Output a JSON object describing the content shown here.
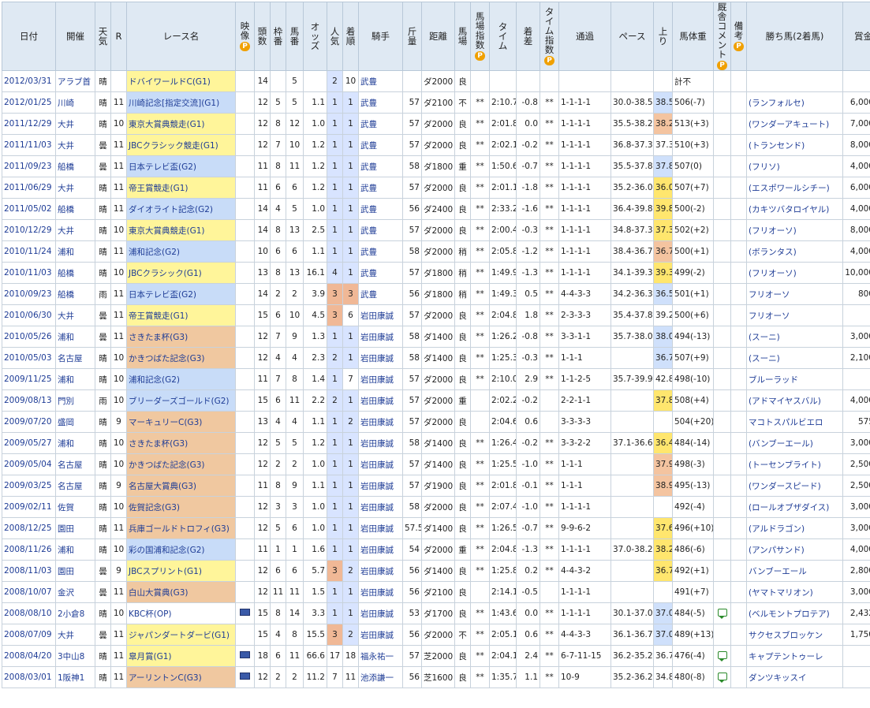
{
  "headers": [
    {
      "label": "日付",
      "pbadge": false
    },
    {
      "label": "開催",
      "pbadge": false
    },
    {
      "label": "天気",
      "pbadge": false,
      "vertical": true
    },
    {
      "label": "R",
      "pbadge": false
    },
    {
      "label": "レース名",
      "pbadge": false
    },
    {
      "label": "映像",
      "pbadge": true,
      "vertical": true
    },
    {
      "label": "頭数",
      "pbadge": false,
      "vertical": true
    },
    {
      "label": "枠番",
      "pbadge": false,
      "vertical": true
    },
    {
      "label": "馬番",
      "pbadge": false,
      "vertical": true
    },
    {
      "label": "オッズ",
      "pbadge": false,
      "vertical": true
    },
    {
      "label": "人気",
      "pbadge": false,
      "vertical": true
    },
    {
      "label": "着順",
      "pbadge": false,
      "vertical": true
    },
    {
      "label": "騎手",
      "pbadge": false
    },
    {
      "label": "斤量",
      "pbadge": false,
      "vertical": true
    },
    {
      "label": "距離",
      "pbadge": false
    },
    {
      "label": "馬場",
      "pbadge": false,
      "vertical": true
    },
    {
      "label": "馬場指数",
      "pbadge": true,
      "vertical": true
    },
    {
      "label": "タイム",
      "pbadge": false,
      "vertical": true
    },
    {
      "label": "着差",
      "pbadge": false,
      "vertical": true
    },
    {
      "label": "タイム指数",
      "pbadge": true,
      "vertical": true
    },
    {
      "label": "通過",
      "pbadge": false
    },
    {
      "label": "ペース",
      "pbadge": false
    },
    {
      "label": "上り",
      "pbadge": false,
      "vertical": true
    },
    {
      "label": "馬体重",
      "pbadge": false
    },
    {
      "label": "厩舎コメント",
      "pbadge": true,
      "vertical": true
    },
    {
      "label": "備考",
      "pbadge": true,
      "vertical": true
    },
    {
      "label": "勝ち馬(2着馬)",
      "pbadge": false
    },
    {
      "label": "賞金",
      "pbadge": false
    }
  ],
  "rows": [
    [
      "2012/03/31",
      "アラブ首",
      "晴",
      "",
      "ドバイワールドC(G1)",
      "",
      "14",
      "",
      "5",
      "",
      "2",
      "10",
      "武豊",
      "",
      "ダ2000",
      "良",
      "",
      "",
      "",
      "",
      "",
      "",
      "",
      "計不",
      "",
      "",
      "",
      ""
    ],
    [
      "2012/01/25",
      "川崎",
      "晴",
      "11",
      "川崎記念[指定交流](G1)",
      "",
      "12",
      "5",
      "5",
      "1.1",
      "1",
      "1",
      "武豊",
      "57",
      "ダ2100",
      "不",
      "**",
      "2:10.7",
      "-0.8",
      "**",
      "1-1-1-1",
      "30.0-38.5",
      "38.5",
      "506(-7)",
      "",
      "",
      "(ランフォルセ)",
      "6,000.0"
    ],
    [
      "2011/12/29",
      "大井",
      "晴",
      "10",
      "東京大賞典競走(G1)",
      "",
      "12",
      "8",
      "12",
      "1.0",
      "1",
      "1",
      "武豊",
      "57",
      "ダ2000",
      "良",
      "**",
      "2:01.8",
      "0.0",
      "**",
      "1-1-1-1",
      "35.5-38.2",
      "38.2",
      "513(+3)",
      "",
      "",
      "(ワンダーアキュート)",
      "7,000.0"
    ],
    [
      "2011/11/03",
      "大井",
      "曇",
      "11",
      "JBCクラシック競走(G1)",
      "",
      "12",
      "7",
      "10",
      "1.2",
      "1",
      "1",
      "武豊",
      "57",
      "ダ2000",
      "良",
      "**",
      "2:02.1",
      "-0.2",
      "**",
      "1-1-1-1",
      "36.8-37.3",
      "37.3",
      "510(+3)",
      "",
      "",
      "(トランセンド)",
      "8,000.0"
    ],
    [
      "2011/09/23",
      "船橋",
      "曇",
      "11",
      "日本テレビ盃(G2)",
      "",
      "11",
      "8",
      "11",
      "1.2",
      "1",
      "1",
      "武豊",
      "58",
      "ダ1800",
      "重",
      "**",
      "1:50.6",
      "-0.7",
      "**",
      "1-1-1-1",
      "35.5-37.8",
      "37.8",
      "507(0)",
      "",
      "",
      "(フリソ)",
      "4,000.0"
    ],
    [
      "2011/06/29",
      "大井",
      "晴",
      "11",
      "帝王賞競走(G1)",
      "",
      "11",
      "6",
      "6",
      "1.2",
      "1",
      "1",
      "武豊",
      "57",
      "ダ2000",
      "良",
      "**",
      "2:01.1",
      "-1.8",
      "**",
      "1-1-1-1",
      "35.2-36.0",
      "36.0",
      "507(+7)",
      "",
      "",
      "(エスポワールシチー)",
      "6,000.0"
    ],
    [
      "2011/05/02",
      "船橋",
      "晴",
      "11",
      "ダイオライト記念(G2)",
      "",
      "14",
      "4",
      "5",
      "1.0",
      "1",
      "1",
      "武豊",
      "56",
      "ダ2400",
      "良",
      "**",
      "2:33.2",
      "-1.6",
      "**",
      "1-1-1-1",
      "36.4-39.8",
      "39.8",
      "500(-2)",
      "",
      "",
      "(カキツバタロイヤル)",
      "4,000.0"
    ],
    [
      "2010/12/29",
      "大井",
      "晴",
      "10",
      "東京大賞典競走(G1)",
      "",
      "14",
      "8",
      "13",
      "2.5",
      "1",
      "1",
      "武豊",
      "57",
      "ダ2000",
      "良",
      "**",
      "2:00.4",
      "-0.3",
      "**",
      "1-1-1-1",
      "34.8-37.3",
      "37.3",
      "502(+2)",
      "",
      "",
      "(フリオーソ)",
      "8,000.0"
    ],
    [
      "2010/11/24",
      "浦和",
      "晴",
      "11",
      "浦和記念(G2)",
      "",
      "10",
      "6",
      "6",
      "1.1",
      "1",
      "1",
      "武豊",
      "58",
      "ダ2000",
      "稍",
      "**",
      "2:05.8",
      "-1.2",
      "**",
      "1-1-1-1",
      "38.4-36.7",
      "36.7",
      "500(+1)",
      "",
      "",
      "(ボランタス)",
      "4,000.0"
    ],
    [
      "2010/11/03",
      "船橋",
      "晴",
      "10",
      "JBCクラシック(G1)",
      "",
      "13",
      "8",
      "13",
      "16.1",
      "4",
      "1",
      "武豊",
      "57",
      "ダ1800",
      "稍",
      "**",
      "1:49.9",
      "-1.3",
      "**",
      "1-1-1-1",
      "34.1-39.3",
      "39.3",
      "499(-2)",
      "",
      "",
      "(フリオーソ)",
      "10,000.0"
    ],
    [
      "2010/09/23",
      "船橋",
      "雨",
      "11",
      "日本テレビ盃(G2)",
      "",
      "14",
      "2",
      "2",
      "3.9",
      "3",
      "3",
      "武豊",
      "56",
      "ダ1800",
      "稍",
      "**",
      "1:49.3",
      "0.5",
      "**",
      "4-4-3-3",
      "34.2-36.3",
      "36.5",
      "501(+1)",
      "",
      "",
      "フリオーソ",
      "800.0"
    ],
    [
      "2010/06/30",
      "大井",
      "曇",
      "11",
      "帝王賞競走(G1)",
      "",
      "15",
      "6",
      "10",
      "4.5",
      "3",
      "6",
      "岩田康誠",
      "57",
      "ダ2000",
      "良",
      "**",
      "2:04.8",
      "1.8",
      "**",
      "2-3-3-3",
      "35.4-37.8",
      "39.2",
      "500(+6)",
      "",
      "",
      "フリオーソ",
      ""
    ],
    [
      "2010/05/26",
      "浦和",
      "曇",
      "11",
      "さきたま杯(G3)",
      "",
      "12",
      "7",
      "9",
      "1.3",
      "1",
      "1",
      "岩田康誠",
      "58",
      "ダ1400",
      "良",
      "**",
      "1:26.2",
      "-0.8",
      "**",
      "3-3-1-1",
      "35.7-38.0",
      "38.0",
      "494(-13)",
      "",
      "",
      "(スーニ)",
      "3,000.0"
    ],
    [
      "2010/05/03",
      "名古屋",
      "晴",
      "10",
      "かきつばた記念(G3)",
      "",
      "12",
      "4",
      "4",
      "2.3",
      "2",
      "1",
      "岩田康誠",
      "58",
      "ダ1400",
      "良",
      "**",
      "1:25.3",
      "-0.3",
      "**",
      "1-1-1",
      "",
      "36.7",
      "507(+9)",
      "",
      "",
      "(スーニ)",
      "2,100.0"
    ],
    [
      "2009/11/25",
      "浦和",
      "晴",
      "10",
      "浦和記念(G2)",
      "",
      "11",
      "7",
      "8",
      "1.4",
      "1",
      "7",
      "岩田康誠",
      "57",
      "ダ2000",
      "良",
      "**",
      "2:10.0",
      "2.9",
      "**",
      "1-1-2-5",
      "35.7-39.9",
      "42.8",
      "498(-10)",
      "",
      "",
      "ブルーラッド",
      ""
    ],
    [
      "2009/08/13",
      "門別",
      "雨",
      "10",
      "ブリーダーズゴールド(G2)",
      "",
      "15",
      "6",
      "11",
      "2.2",
      "2",
      "1",
      "岩田康誠",
      "57",
      "ダ2000",
      "重",
      "",
      "2:02.2",
      "-0.2",
      "",
      "2-2-1-1",
      "",
      "37.8",
      "508(+4)",
      "",
      "",
      "(アドマイヤスバル)",
      "4,000.0"
    ],
    [
      "2009/07/20",
      "盛岡",
      "晴",
      "9",
      "マーキュリーC(G3)",
      "",
      "13",
      "4",
      "4",
      "1.1",
      "1",
      "2",
      "岩田康誠",
      "57",
      "ダ2000",
      "良",
      "",
      "2:04.6",
      "0.6",
      "",
      "3-3-3-3",
      "",
      "",
      "504(+20)",
      "",
      "",
      "マコトスパルビエロ",
      "575.0"
    ],
    [
      "2009/05/27",
      "浦和",
      "晴",
      "10",
      "さきたま杯(G3)",
      "",
      "12",
      "5",
      "5",
      "1.2",
      "1",
      "1",
      "岩田康誠",
      "58",
      "ダ1400",
      "良",
      "**",
      "1:26.4",
      "-0.2",
      "**",
      "3-3-2-2",
      "37.1-36.6",
      "36.4",
      "484(-14)",
      "",
      "",
      "(バンブーエール)",
      "3,000.0"
    ],
    [
      "2009/05/04",
      "名古屋",
      "晴",
      "10",
      "かきつばた記念(G3)",
      "",
      "12",
      "2",
      "2",
      "1.0",
      "1",
      "1",
      "岩田康誠",
      "57",
      "ダ1400",
      "良",
      "**",
      "1:25.5",
      "-1.0",
      "**",
      "1-1-1",
      "",
      "37.9",
      "498(-3)",
      "",
      "",
      "(トーセンブライト)",
      "2,500.0"
    ],
    [
      "2009/03/25",
      "名古屋",
      "晴",
      "9",
      "名古屋大賞典(G3)",
      "",
      "11",
      "8",
      "9",
      "1.1",
      "1",
      "1",
      "岩田康誠",
      "57",
      "ダ1900",
      "良",
      "**",
      "2:01.8",
      "-0.1",
      "**",
      "1-1-1",
      "",
      "38.9",
      "495(-13)",
      "",
      "",
      "(ワンダースピード)",
      "2,500.0"
    ],
    [
      "2009/02/11",
      "佐賀",
      "晴",
      "10",
      "佐賀記念(G3)",
      "",
      "12",
      "3",
      "3",
      "1.0",
      "1",
      "1",
      "岩田康誠",
      "58",
      "ダ2000",
      "良",
      "**",
      "2:07.4",
      "-1.0",
      "**",
      "1-1-1-1",
      "",
      "",
      "492(-4)",
      "",
      "",
      "(ロールオブザダイス)",
      "3,000.0"
    ],
    [
      "2008/12/25",
      "園田",
      "晴",
      "11",
      "兵庫ゴールドトロフィ(G3)",
      "",
      "12",
      "5",
      "6",
      "1.0",
      "1",
      "1",
      "岩田康誠",
      "57.5",
      "ダ1400",
      "良",
      "**",
      "1:26.5",
      "-0.7",
      "**",
      "9-9-6-2",
      "",
      "37.6",
      "496(+10)",
      "",
      "",
      "(アルドラゴン)",
      "3,000.0"
    ],
    [
      "2008/11/26",
      "浦和",
      "晴",
      "10",
      "彩の国浦和記念(G2)",
      "",
      "11",
      "1",
      "1",
      "1.6",
      "1",
      "1",
      "岩田康誠",
      "54",
      "ダ2000",
      "重",
      "**",
      "2:04.8",
      "-1.3",
      "**",
      "1-1-1-1",
      "37.0-38.2",
      "38.2",
      "486(-6)",
      "",
      "",
      "(アンパサンド)",
      "4,000.0"
    ],
    [
      "2008/11/03",
      "園田",
      "曇",
      "9",
      "JBCスプリント(G1)",
      "",
      "12",
      "6",
      "6",
      "5.7",
      "3",
      "2",
      "岩田康誠",
      "56",
      "ダ1400",
      "良",
      "**",
      "1:25.8",
      "0.2",
      "**",
      "4-4-3-2",
      "",
      "36.7",
      "492(+1)",
      "",
      "",
      "バンブーエール",
      "2,800.0"
    ],
    [
      "2008/10/07",
      "金沢",
      "曇",
      "11",
      "白山大賞典(G3)",
      "",
      "12",
      "11",
      "11",
      "1.5",
      "1",
      "1",
      "岩田康誠",
      "56",
      "ダ2100",
      "良",
      "",
      "2:14.1",
      "-0.5",
      "",
      "1-1-1-1",
      "",
      "",
      "491(+7)",
      "",
      "",
      "(ヤマトマリオン)",
      "3,000.0"
    ],
    [
      "2008/08/10",
      "2小倉8",
      "晴",
      "10",
      "KBC杯(OP)",
      "▶",
      "15",
      "8",
      "14",
      "3.3",
      "1",
      "1",
      "岩田康誠",
      "53",
      "ダ1700",
      "良",
      "**",
      "1:43.6",
      "0.0",
      "**",
      "1-1-1-1",
      "30.1-37.0",
      "37.0",
      "484(-5)",
      "💬",
      "",
      "(ベルモントプロテア)",
      "2,432.2"
    ],
    [
      "2008/07/09",
      "大井",
      "曇",
      "11",
      "ジャパンダートダービ(G1)",
      "",
      "15",
      "4",
      "8",
      "15.5",
      "3",
      "2",
      "岩田康誠",
      "56",
      "ダ2000",
      "不",
      "**",
      "2:05.1",
      "0.6",
      "**",
      "4-4-3-3",
      "36.1-36.7",
      "37.0",
      "489(+13)",
      "",
      "",
      "サクセスブロッケン",
      "1,750.0"
    ],
    [
      "2008/04/20",
      "3中山8",
      "晴",
      "11",
      "皐月賞(G1)",
      "▶",
      "18",
      "6",
      "11",
      "66.6",
      "17",
      "18",
      "福永祐一",
      "57",
      "芝2000",
      "良",
      "**",
      "2:04.1",
      "2.4",
      "**",
      "6-7-11-15",
      "36.2-35.2",
      "36.7",
      "476(-4)",
      "💬",
      "",
      "キャプテントゥーレ",
      ""
    ],
    [
      "2008/03/01",
      "1阪神1",
      "晴",
      "11",
      "アーリントンC(G3)",
      "▶",
      "12",
      "2",
      "2",
      "11.2",
      "7",
      "11",
      "池添謙一",
      "56",
      "芝1600",
      "良",
      "**",
      "1:35.7",
      "1.1",
      "**",
      "10-9",
      "35.2-36.2",
      "34.8",
      "480(-8)",
      "💬",
      "",
      "ダンツキッスイ",
      ""
    ]
  ],
  "race_grade_colors": [
    "gold",
    "blue",
    "gold",
    "gold",
    "blue",
    "gold",
    "blue",
    "gold",
    "blue",
    "gold",
    "blue",
    "gold",
    "orange",
    "orange",
    "blue",
    "blue",
    "orange",
    "orange",
    "orange",
    "orange",
    "orange",
    "orange",
    "blue",
    "gold",
    "orange",
    "",
    "gold",
    "gold",
    "orange"
  ],
  "popularity_colors": [
    "pop1",
    "pop1",
    "pop1",
    "pop1",
    "pop1",
    "pop1",
    "pop1",
    "pop1",
    "pop1",
    "pop1",
    "pop3",
    "pop3",
    "pop1",
    "pop1",
    "pop1",
    "pop1",
    "pop1",
    "pop1",
    "pop1",
    "pop1",
    "pop1",
    "pop1",
    "pop1",
    "pop3",
    "pop1",
    "pop1",
    "pop3",
    "",
    ""
  ],
  "finish_colors": [
    "",
    "pop1",
    "pop1",
    "pop1",
    "pop1",
    "pop1",
    "pop1",
    "pop1",
    "pop1",
    "pop1",
    "pop3",
    "",
    "pop1",
    "pop1",
    "",
    "pop1",
    "pop1",
    "pop1",
    "pop1",
    "pop1",
    "pop1",
    "pop1",
    "pop1",
    "pop1",
    "pop1",
    "pop1",
    "pop1",
    "",
    ""
  ],
  "agari_colors": [
    "",
    "u-b",
    "u-o",
    "",
    "u-b",
    "u-y",
    "u-y",
    "u-y",
    "u-o",
    "u-y",
    "u-b",
    "",
    "u-b",
    "u-b",
    "",
    "u-y",
    "",
    "u-y",
    "u-o",
    "u-o",
    "",
    "u-y",
    "u-y",
    "u-y",
    "",
    "u-b",
    "u-b",
    "",
    ""
  ]
}
